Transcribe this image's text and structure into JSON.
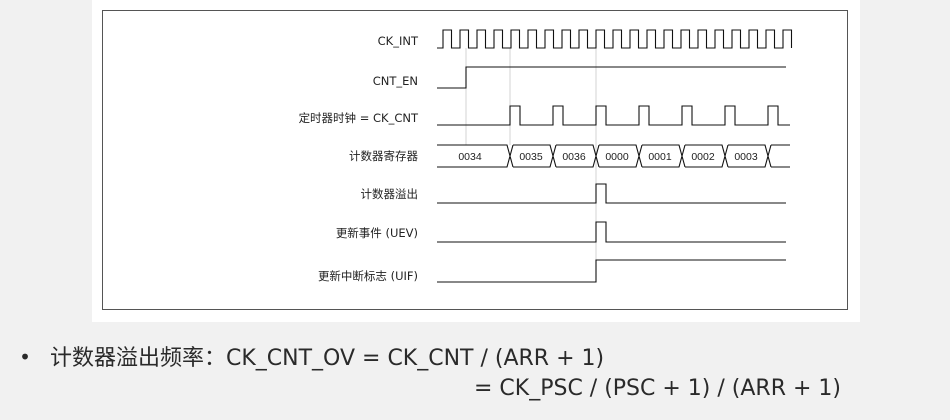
{
  "diagram": {
    "signals": [
      {
        "id": "ck_int",
        "label": "CK_INT"
      },
      {
        "id": "cnt_en",
        "label": "CNT_EN"
      },
      {
        "id": "timer_clock",
        "label": "定时器时钟 = CK_CNT"
      },
      {
        "id": "counter_register",
        "label": "计数器寄存器"
      },
      {
        "id": "counter_overflow",
        "label": "计数器溢出"
      },
      {
        "id": "update_event",
        "label": "更新事件 (UEV)"
      },
      {
        "id": "update_interrupt_flag",
        "label": "更新中断标志 (UIF)"
      }
    ],
    "register_values": [
      "0034",
      "0035",
      "0036",
      "0000",
      "0001",
      "0002",
      "0003"
    ]
  },
  "formula": {
    "bullet": "•",
    "line1": "计数器溢出频率：CK_CNT_OV = CK_CNT / (ARR + 1)",
    "line2": "= CK_PSC / (PSC + 1) / (ARR + 1)"
  }
}
